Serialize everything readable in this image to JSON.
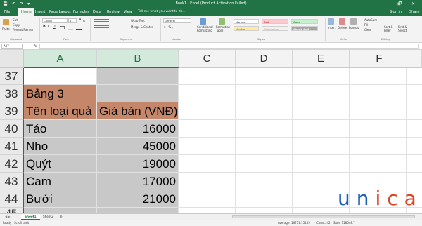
{
  "window": {
    "title": "Book1 - Excel (Product Activation Failed)",
    "qat": "💾 ↶ ↷ ▾",
    "controls": "🗕 🗗 ✕"
  },
  "menu_tabs": [
    {
      "label": "File"
    },
    {
      "label": "Home"
    },
    {
      "label": "Insert"
    },
    {
      "label": "Page Layout"
    },
    {
      "label": "Formulas"
    },
    {
      "label": "Data"
    },
    {
      "label": "Review"
    },
    {
      "label": "View"
    }
  ],
  "tell_me": "Tell me what you want to do...",
  "sign_in": "Sign in",
  "share": "Share",
  "ribbon": {
    "paste": "Paste",
    "cut": "Cut",
    "copy": "Copy",
    "format_painter": "Format Painter",
    "clipboard": "Clipboard",
    "font_name": "Calibri",
    "font_size": "11",
    "bold": "B",
    "italic": "I",
    "underline": "U",
    "grow": "A",
    "shrink": "A",
    "font": "Font",
    "wrap_text": "Wrap Text",
    "merge_center": "Merge & Center",
    "alignment": "Alignment",
    "number_format": "General",
    "currency": "$ - % ,",
    "number": "Number",
    "conditional_formatting": "Conditional Formatting",
    "format_as_table": "Format as Table",
    "styles": {
      "normal": "Normal",
      "bad": "Bad",
      "good": "Good",
      "neutral": "Neutral",
      "calculation": "Calculation",
      "check_cell": "Check Cell"
    },
    "styles_label": "Styles",
    "insert": "Insert",
    "delete": "Delete",
    "format": "Format",
    "cells": "Cells",
    "autosum": "AutoSum",
    "fill": "Fill",
    "clear": "Clear",
    "sort_filter": "Sort & Filter",
    "find_select": "Find & Select",
    "editing": "Editing"
  },
  "formula_bar": {
    "name_box": "A37",
    "fx": "fx",
    "formula": ""
  },
  "columns": [
    "A",
    "B",
    "C",
    "D",
    "E",
    "F"
  ],
  "rows": [
    {
      "num": "37",
      "a": "",
      "b": ""
    },
    {
      "num": "38",
      "a": "Bảng 3",
      "b": ""
    },
    {
      "num": "39",
      "a": "Tên loại quả",
      "b": "Giá bán (VNĐ)"
    },
    {
      "num": "40",
      "a": "Táo",
      "b": "16000"
    },
    {
      "num": "41",
      "a": "Nho",
      "b": "45000"
    },
    {
      "num": "42",
      "a": "Quýt",
      "b": "19000"
    },
    {
      "num": "43",
      "a": "Cam",
      "b": "17000"
    },
    {
      "num": "44",
      "a": "Bưởi",
      "b": "21000"
    },
    {
      "num": "45",
      "a": "",
      "b": ""
    }
  ],
  "sheets": [
    "Sheet1",
    "Sheet2"
  ],
  "add_sheet": "⊕",
  "status": {
    "ready": "Ready",
    "scroll_lock": "Scroll Lock",
    "average": "Average: 16731.15455",
    "count": "Count: 42",
    "sum": "Sum: 118648.7"
  },
  "watermark": {
    "part1": "un",
    "part2": "ica"
  },
  "colors": {
    "excel_green": "#217346",
    "header_brown": "#c5876a",
    "data_gray": "#c8c8c8",
    "white_cell": "#ffffff"
  }
}
